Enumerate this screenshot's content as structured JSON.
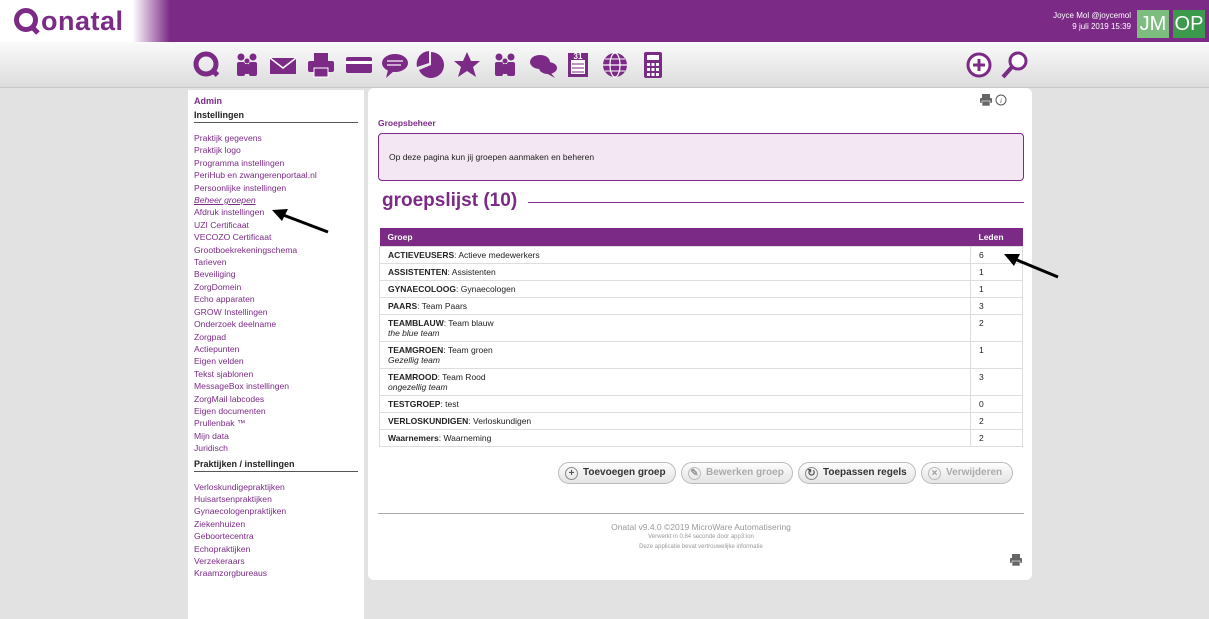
{
  "header": {
    "logo_text": "onatal",
    "user_name": "Joyce Mol @joycemol",
    "datetime": "9 juli 2019 15:39",
    "avatars": [
      "JM",
      "OP"
    ],
    "brand_color": "#7b2a86"
  },
  "toolbar": {
    "icons": [
      "onatal-q-icon",
      "people-icon",
      "mail-icon",
      "printer-icon",
      "card-icon",
      "chat-icon",
      "pie-chart-icon",
      "star-icon",
      "people-group-icon",
      "chat-bubbles-icon",
      "calendar-icon",
      "globe-icon",
      "calculator-icon",
      "add-icon",
      "search-icon"
    ],
    "calendar_day": "31"
  },
  "sidebar": {
    "admin_label": "Admin",
    "section1_title": "Instellingen",
    "items": [
      "Praktijk gegevens",
      "Praktijk logo",
      "Programma instellingen",
      "PeriHub en zwangerenportaal.nl",
      "Persoonlijke instellingen",
      "Beheer groepen",
      "Afdruk instellingen",
      "UZI Certificaat",
      "VECOZO Certificaat",
      "Grootboekrekeningschema",
      "Tarieven",
      "Beveiliging",
      "ZorgDomein",
      "Echo apparaten",
      "GROW Instellingen",
      "Onderzoek deelname",
      "Zorgpad",
      "Actiepunten",
      "Eigen velden",
      "Tekst sjablonen",
      "MessageBox instellingen",
      "ZorgMail labcodes",
      "Eigen documenten",
      "Prullenbak ™",
      "Mijn data",
      "Juridisch"
    ],
    "active_index": 5,
    "section2_title": "Praktijken / instellingen",
    "items2": [
      "Verloskundigepraktijken",
      "Huisartsenpraktijken",
      "Gynaecologenpraktijken",
      "Ziekenhuizen",
      "Geboortecentra",
      "Echopraktijken",
      "Verzekeraars",
      "Kraamzorgbureaus"
    ]
  },
  "main": {
    "breadcrumb": "Groepsbeheer",
    "info_text": "Op deze pagina kun jij groepen aanmaken en beheren",
    "list_title_first": "g",
    "list_title_rest": "roepslijst (10)",
    "table": {
      "headers": [
        "Groep",
        "Leden"
      ],
      "rows": [
        {
          "code": "ACTIEVEUSERS",
          "name": ": Actieve medewerkers",
          "desc": "",
          "count": "6"
        },
        {
          "code": "ASSISTENTEN",
          "name": ": Assistenten",
          "desc": "",
          "count": "1"
        },
        {
          "code": "GYNAECOLOOG",
          "name": ": Gynaecologen",
          "desc": "",
          "count": "1"
        },
        {
          "code": "PAARS",
          "name": ": Team Paars",
          "desc": "",
          "count": "3"
        },
        {
          "code": "TEAMBLAUW",
          "name": ": Team blauw",
          "desc": "the blue team",
          "count": "2"
        },
        {
          "code": "TEAMGROEN",
          "name": ": Team groen",
          "desc": "Gezellig team",
          "count": "1"
        },
        {
          "code": "TEAMROOD",
          "name": ": Team Rood",
          "desc": "ongezellig team",
          "count": "3"
        },
        {
          "code": "TESTGROEP",
          "name": ": test",
          "desc": "",
          "count": "0"
        },
        {
          "code": "VERLOSKUNDIGEN",
          "name": ": Verloskundigen",
          "desc": "",
          "count": "2"
        },
        {
          "code": "Waarnemers",
          "name": ": Waarneming",
          "desc": "",
          "count": "2"
        }
      ]
    },
    "buttons": {
      "add": "Toevoegen groep",
      "edit": "Bewerken groep",
      "apply": "Toepassen regels",
      "delete": "Verwijderen"
    },
    "footer": {
      "line1": "Onatal v9.4.0 ©2019 MicroWare Automatisering",
      "line2": "Verwerkt in 0.84 seconde door app3:ion",
      "line3": "Deze applicatie bevat vertrouwelijke informatie"
    }
  }
}
